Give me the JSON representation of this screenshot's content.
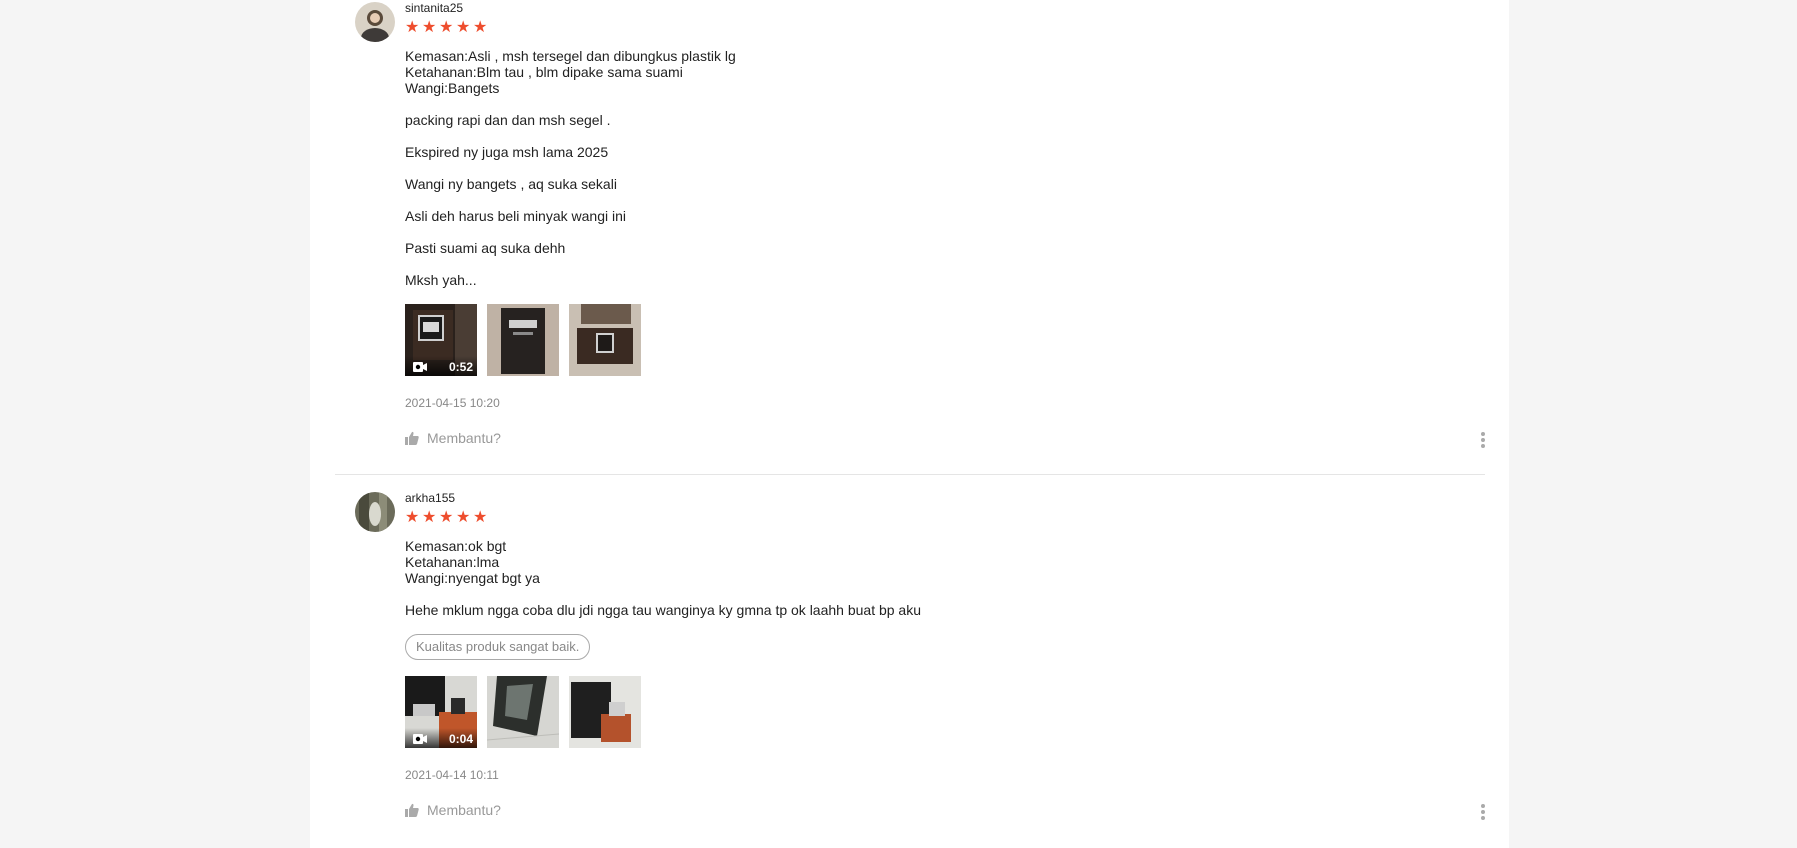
{
  "reviews": [
    {
      "username": "sintanita25",
      "rating": 5,
      "lines": [
        "Kemasan:Asli , msh tersegel dan dibungkus plastik lg",
        "Ketahanan:Blm tau , blm dipake sama suami",
        "Wangi:Bangets"
      ],
      "paragraphs": [
        "packing rapi dan dan msh segel .",
        "Ekspired ny juga msh lama 2025",
        "Wangi ny bangets , aq suka sekali",
        "Asli deh harus beli minyak wangi ini",
        "Pasti suami aq suka dehh",
        "Mksh yah..."
      ],
      "tag": "",
      "video_duration": "0:52",
      "timestamp": "2021-04-15 10:20",
      "helpful_label": "Membantu?"
    },
    {
      "username": "arkha155",
      "rating": 5,
      "lines": [
        "Kemasan:ok bgt",
        "Ketahanan:lma",
        "Wangi:nyengat bgt ya"
      ],
      "paragraphs": [
        "Hehe mklum ngga coba dlu jdi ngga tau wanginya ky gmna tp ok laahh buat bp aku"
      ],
      "tag": "Kualitas produk sangat baik.",
      "video_duration": "0:04",
      "timestamp": "2021-04-14 10:11",
      "helpful_label": "Membantu?"
    }
  ],
  "colors": {
    "star": "#ee4d2d",
    "muted": "#888888",
    "background": "#f5f5f5"
  },
  "icons": [
    "star-icon",
    "video-camera-icon",
    "thumbs-up-icon",
    "more-vertical-icon"
  ]
}
